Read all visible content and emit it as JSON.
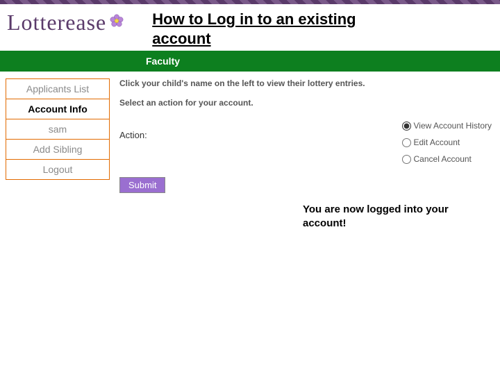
{
  "logo": {
    "text": "Lotterease"
  },
  "title": "How to Log in to an existing account",
  "green_bar": {
    "label": "Faculty"
  },
  "sidebar": {
    "items": [
      {
        "label": "Applicants List",
        "active": false
      },
      {
        "label": "Account Info",
        "active": true
      },
      {
        "label": "sam",
        "active": false
      },
      {
        "label": "Add Sibling",
        "active": false
      },
      {
        "label": "Logout",
        "active": false
      }
    ]
  },
  "content": {
    "instr1": "Click your child's name on the left to view their lottery entries.",
    "instr2": "Select an action for your account.",
    "action_label": "Action:",
    "radios": [
      {
        "label": "View Account History",
        "checked": true
      },
      {
        "label": "Edit Account",
        "checked": false
      },
      {
        "label": "Cancel Account",
        "checked": false
      }
    ],
    "submit_label": "Submit"
  },
  "note": "You are now logged into your account!"
}
